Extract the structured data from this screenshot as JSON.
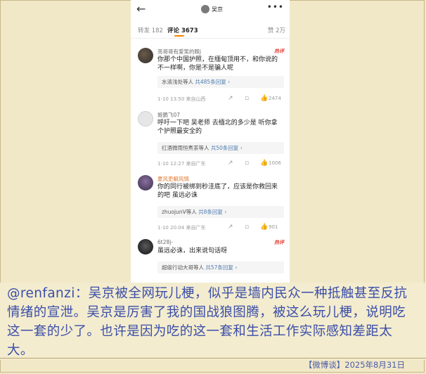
{
  "header": {
    "back_icon": "back-arrow-icon",
    "user_name": "吴京",
    "more_icon": "more-dots-icon"
  },
  "tabs": {
    "repost": "转发 182",
    "comments": "评论 3673",
    "likes": "赞 2万",
    "accent": "#ff8200"
  },
  "comments": [
    {
      "nick": "亮哥哥有爱笑的眼j",
      "badge": "热评",
      "text": "你那个中国护照，在缅甸顶用不，和你说的不一样啊，你是不是骗人呢",
      "reply_names": "水清浅处等人",
      "reply_count": "共485条回复 ›",
      "time": "1-10 13:50 来自山西",
      "likes": "2474"
    },
    {
      "nick": "姬鹏飞07",
      "badge": "",
      "text": "呼吁一下吧  吴老师  去缅北的多少是  听你拿个护照最安全的",
      "reply_names": "红酒微雨恒煮茶等人",
      "reply_count": "共50条回复 ›",
      "time": "1-10 12:27 来自广东",
      "likes": "1006"
    },
    {
      "nick": "夏风吏解风情",
      "badge": "",
      "text": "你的同行被绑到秒洼底了，应该是你救回来的吧 虽远必诛",
      "reply_names": "zhuojunV等人",
      "reply_count": "共8条回复 ›",
      "time": "1-10 20:04 来自广东",
      "likes": "901"
    },
    {
      "nick": "6t28j-",
      "badge": "热评",
      "text": "虽远必诛，出来说句话呀",
      "reply_names": "超级行动大哥等人",
      "reply_count": "共57条回复 ›",
      "time": "",
      "likes": ""
    }
  ],
  "caption": {
    "text": "@renfanzi：吴京被全网玩儿梗，似乎是墙内民众一种抵触甚至反抗情绪的宣泄。吴京是厉害了我的国战狼图腾，被这么玩儿梗，说明吃这一套的少了。也许是因为吃的这一套和生活工作实际感知差距太大。",
    "footer": "【微博谈】2025年8月31日"
  },
  "colors": {
    "caption_text": "#3b4ea8",
    "background": "#f1e8c8",
    "hot_badge": "#e5483d"
  }
}
